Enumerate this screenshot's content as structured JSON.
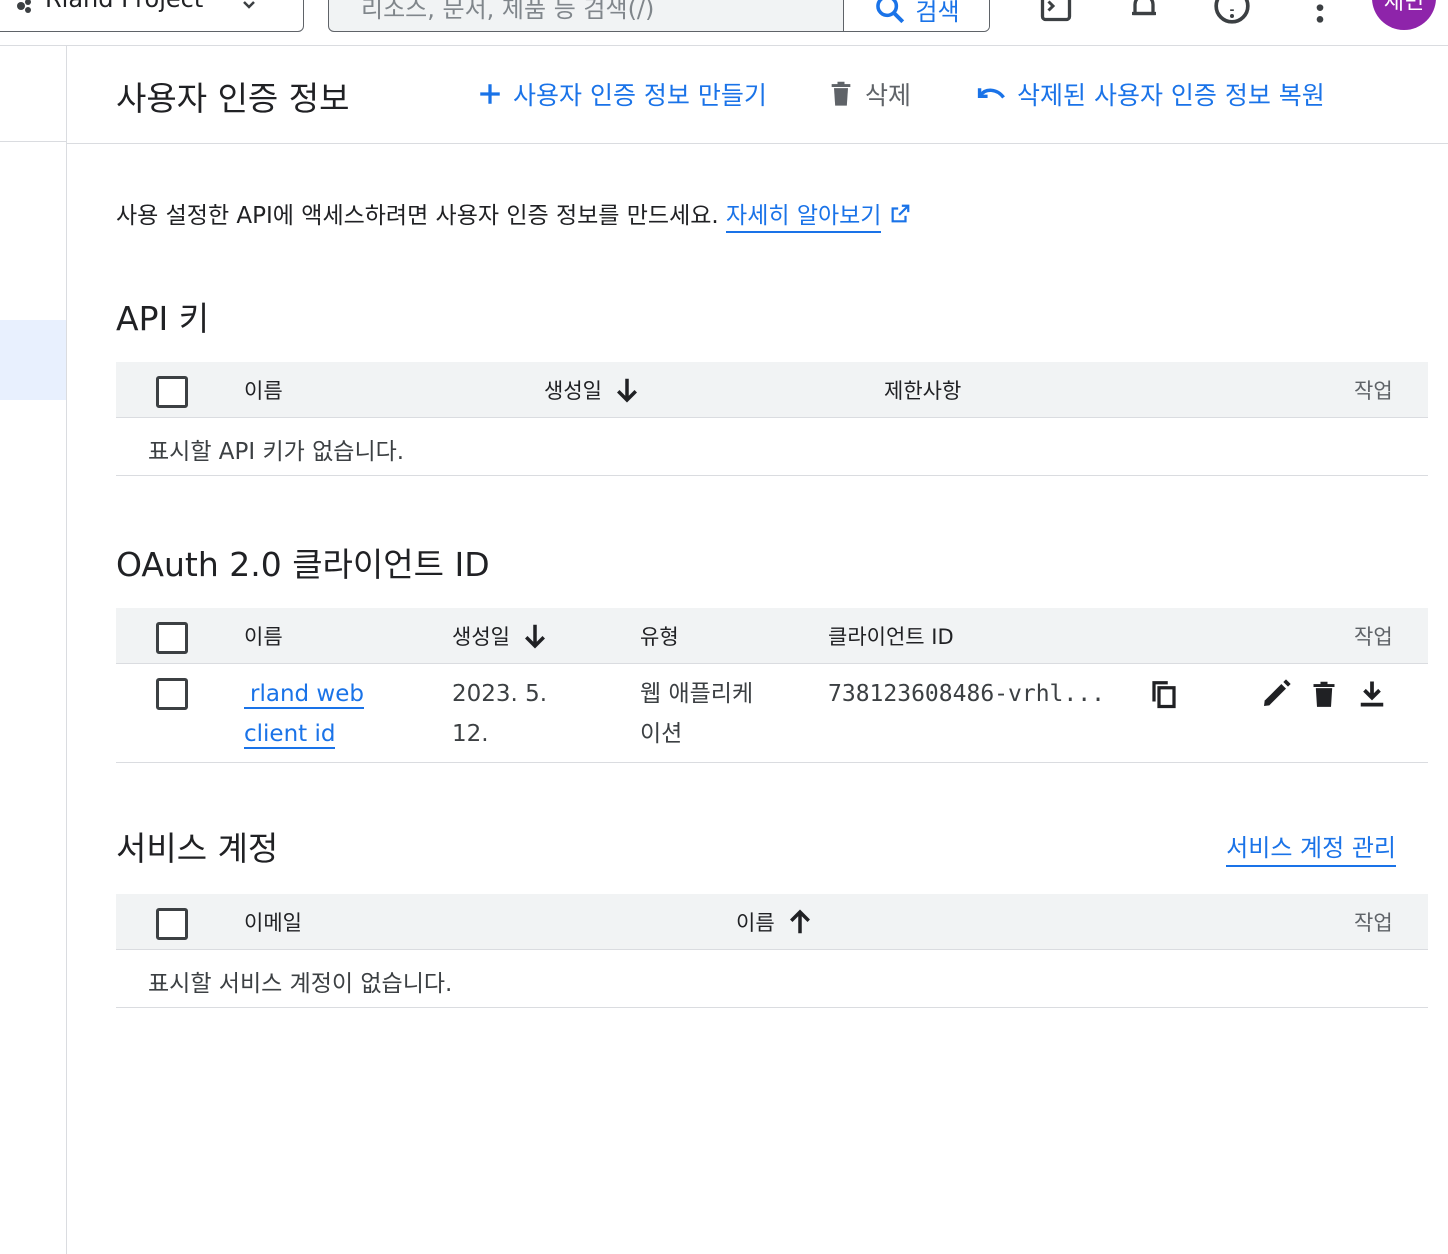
{
  "topbar": {
    "project_name": "Rland Project",
    "search_placeholder": "리소스, 문서, 제품 등 검색(/)",
    "search_button": "검색",
    "avatar_text": "재민"
  },
  "header": {
    "title": "사용자 인증 정보",
    "create_label": "사용자 인증 정보 만들기",
    "delete_label": "삭제",
    "restore_label": "삭제된 사용자 인증 정보 복원"
  },
  "intro": {
    "text": "사용 설정한 API에 액세스하려면 사용자 인증 정보를 만드세요. ",
    "learn_more": "자세히 알아보기"
  },
  "api_keys": {
    "title": "API 키",
    "columns": {
      "name": "이름",
      "created": "생성일",
      "restrictions": "제한사항",
      "actions": "작업"
    },
    "empty": "표시할 API 키가 없습니다."
  },
  "oauth": {
    "title": "OAuth 2.0 클라이언트 ID",
    "columns": {
      "name": "이름",
      "created": "생성일",
      "type": "유형",
      "client_id": "클라이언트 ID",
      "actions": "작업"
    },
    "rows": [
      {
        "name_line1": "rland web",
        "name_line2": "client id",
        "created_line1": "2023. 5.",
        "created_line2": "12.",
        "type_line1": "웹 애플리케",
        "type_line2": "이션",
        "client_id": "738123608486-vrhl..."
      }
    ]
  },
  "service_accounts": {
    "title": "서비스 계정",
    "manage_link": "서비스 계정 관리",
    "columns": {
      "email": "이메일",
      "name": "이름",
      "actions": "작업"
    },
    "empty": "표시할 서비스 계정이 없습니다."
  },
  "colors": {
    "accent": "#1a73e8",
    "avatar": "#8e24aa",
    "header_bg": "#f1f3f4"
  },
  "icons": [
    "plus-icon",
    "trash-icon",
    "undo-icon",
    "external-link-icon",
    "arrow-down-icon",
    "arrow-up-icon",
    "copy-icon",
    "edit-icon",
    "download-icon",
    "search-icon"
  ]
}
